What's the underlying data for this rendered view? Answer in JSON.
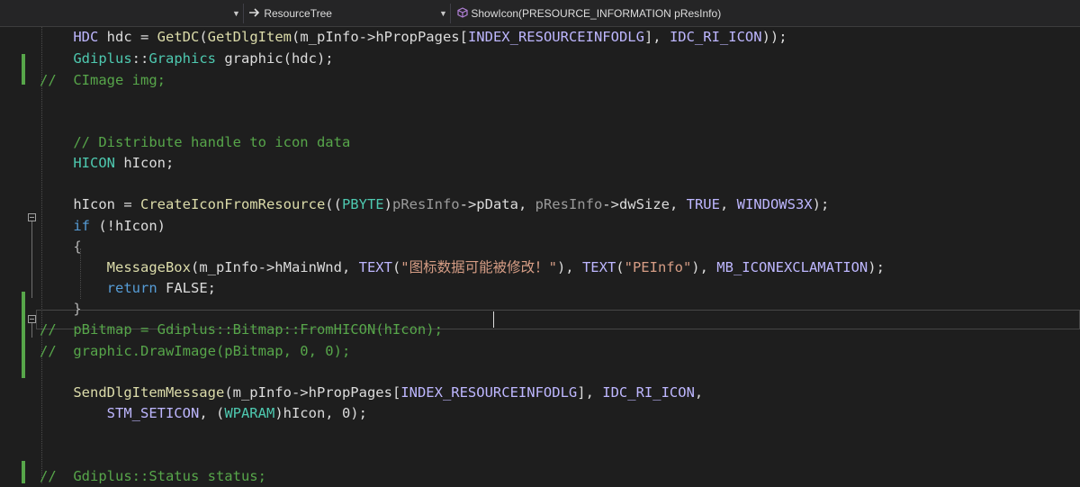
{
  "navbar": {
    "class_name": "ResourceTree",
    "method_name": "ShowIcon(PRESOURCE_INFORMATION pResInfo)",
    "class_icon": "arrow-right-icon",
    "method_icon": "method-cube-icon"
  },
  "code_lines": [
    {
      "indent": "    ",
      "tokens": [
        {
          "t": "HDC",
          "c": "macro"
        },
        {
          "t": " hdc = ",
          "c": "plain"
        },
        {
          "t": "GetDC",
          "c": "func"
        },
        {
          "t": "(",
          "c": "plain"
        },
        {
          "t": "GetDlgItem",
          "c": "func"
        },
        {
          "t": "(m_pInfo->hPropPages[",
          "c": "plain"
        },
        {
          "t": "INDEX_RESOURCEINFODLG",
          "c": "macro"
        },
        {
          "t": "], ",
          "c": "plain"
        },
        {
          "t": "IDC_RI_ICON",
          "c": "macro"
        },
        {
          "t": "));",
          "c": "plain"
        }
      ]
    },
    {
      "indent": "    ",
      "tokens": [
        {
          "t": "Gdiplus",
          "c": "type"
        },
        {
          "t": "::",
          "c": "plain"
        },
        {
          "t": "Graphics",
          "c": "type"
        },
        {
          "t": " graphic(hdc);",
          "c": "plain"
        }
      ]
    },
    {
      "indent": "",
      "tokens": [
        {
          "t": "//  CImage img;",
          "c": "cmt"
        }
      ]
    },
    {
      "indent": "",
      "tokens": []
    },
    {
      "indent": "",
      "tokens": []
    },
    {
      "indent": "    ",
      "tokens": [
        {
          "t": "// Distribute handle to icon data",
          "c": "cmt"
        }
      ]
    },
    {
      "indent": "    ",
      "tokens": [
        {
          "t": "HICON",
          "c": "type"
        },
        {
          "t": " hIcon;",
          "c": "plain"
        }
      ]
    },
    {
      "indent": "",
      "tokens": []
    },
    {
      "indent": "    ",
      "tokens": [
        {
          "t": "hIcon = ",
          "c": "plain"
        },
        {
          "t": "CreateIconFromResource",
          "c": "func"
        },
        {
          "t": "((",
          "c": "plain"
        },
        {
          "t": "PBYTE",
          "c": "type"
        },
        {
          "t": ")",
          "c": "plain"
        },
        {
          "t": "pResInfo",
          "c": "param"
        },
        {
          "t": "->pData, ",
          "c": "plain"
        },
        {
          "t": "pResInfo",
          "c": "param"
        },
        {
          "t": "->dwSize, ",
          "c": "plain"
        },
        {
          "t": "TRUE",
          "c": "macro"
        },
        {
          "t": ", ",
          "c": "plain"
        },
        {
          "t": "WINDOWS3X",
          "c": "macro"
        },
        {
          "t": ");",
          "c": "plain"
        }
      ]
    },
    {
      "indent": "    ",
      "tokens": [
        {
          "t": "if",
          "c": "kw"
        },
        {
          "t": " (!hIcon)",
          "c": "plain"
        }
      ]
    },
    {
      "indent": "    ",
      "tokens": [
        {
          "t": "{",
          "c": "punct"
        }
      ]
    },
    {
      "indent": "        ",
      "tokens": [
        {
          "t": "MessageBox",
          "c": "func"
        },
        {
          "t": "(m_pInfo->hMainWnd, ",
          "c": "plain"
        },
        {
          "t": "TEXT",
          "c": "macro"
        },
        {
          "t": "(",
          "c": "plain"
        },
        {
          "t": "\"图标数据可能被修改！\"",
          "c": "str"
        },
        {
          "t": "), ",
          "c": "plain"
        },
        {
          "t": "TEXT",
          "c": "macro"
        },
        {
          "t": "(",
          "c": "plain"
        },
        {
          "t": "\"PEInfo\"",
          "c": "str"
        },
        {
          "t": "), ",
          "c": "plain"
        },
        {
          "t": "MB_ICONEXCLAMATION",
          "c": "macro"
        },
        {
          "t": ");",
          "c": "plain"
        }
      ]
    },
    {
      "indent": "        ",
      "tokens": [
        {
          "t": "return",
          "c": "kw"
        },
        {
          "t": " FALSE;",
          "c": "plain"
        }
      ]
    },
    {
      "indent": "    ",
      "tokens": [
        {
          "t": "}",
          "c": "punct"
        }
      ]
    },
    {
      "indent": "",
      "tokens": [
        {
          "t": "//  pBitmap = Gdiplus::Bitmap::FromHICON(hIcon);",
          "c": "cmt"
        }
      ]
    },
    {
      "indent": "",
      "tokens": [
        {
          "t": "//  graphic.DrawImage(pBitmap, 0, 0);",
          "c": "cmt"
        }
      ]
    },
    {
      "indent": "",
      "tokens": []
    },
    {
      "indent": "    ",
      "tokens": [
        {
          "t": "SendDlgItemMessage",
          "c": "func"
        },
        {
          "t": "(m_pInfo->hPropPages[",
          "c": "plain"
        },
        {
          "t": "INDEX_RESOURCEINFODLG",
          "c": "macro"
        },
        {
          "t": "], ",
          "c": "plain"
        },
        {
          "t": "IDC_RI_ICON",
          "c": "macro"
        },
        {
          "t": ",",
          "c": "plain"
        }
      ]
    },
    {
      "indent": "        ",
      "tokens": [
        {
          "t": "STM_SETICON",
          "c": "macro"
        },
        {
          "t": ", (",
          "c": "plain"
        },
        {
          "t": "WPARAM",
          "c": "type"
        },
        {
          "t": ")hIcon, 0);",
          "c": "plain"
        }
      ]
    },
    {
      "indent": "",
      "tokens": []
    },
    {
      "indent": "",
      "tokens": []
    },
    {
      "indent": "",
      "tokens": [
        {
          "t": "//  Gdiplus::Status status;",
          "c": "cmt"
        }
      ]
    }
  ],
  "colors": {
    "background": "#1e1e1e",
    "keyword": "#569cd6",
    "type": "#4ec9b0",
    "macro": "#beb7ff",
    "function": "#dcdcaa",
    "comment": "#57a64a",
    "string": "#d69d85",
    "change_bar": "#57a64a"
  }
}
